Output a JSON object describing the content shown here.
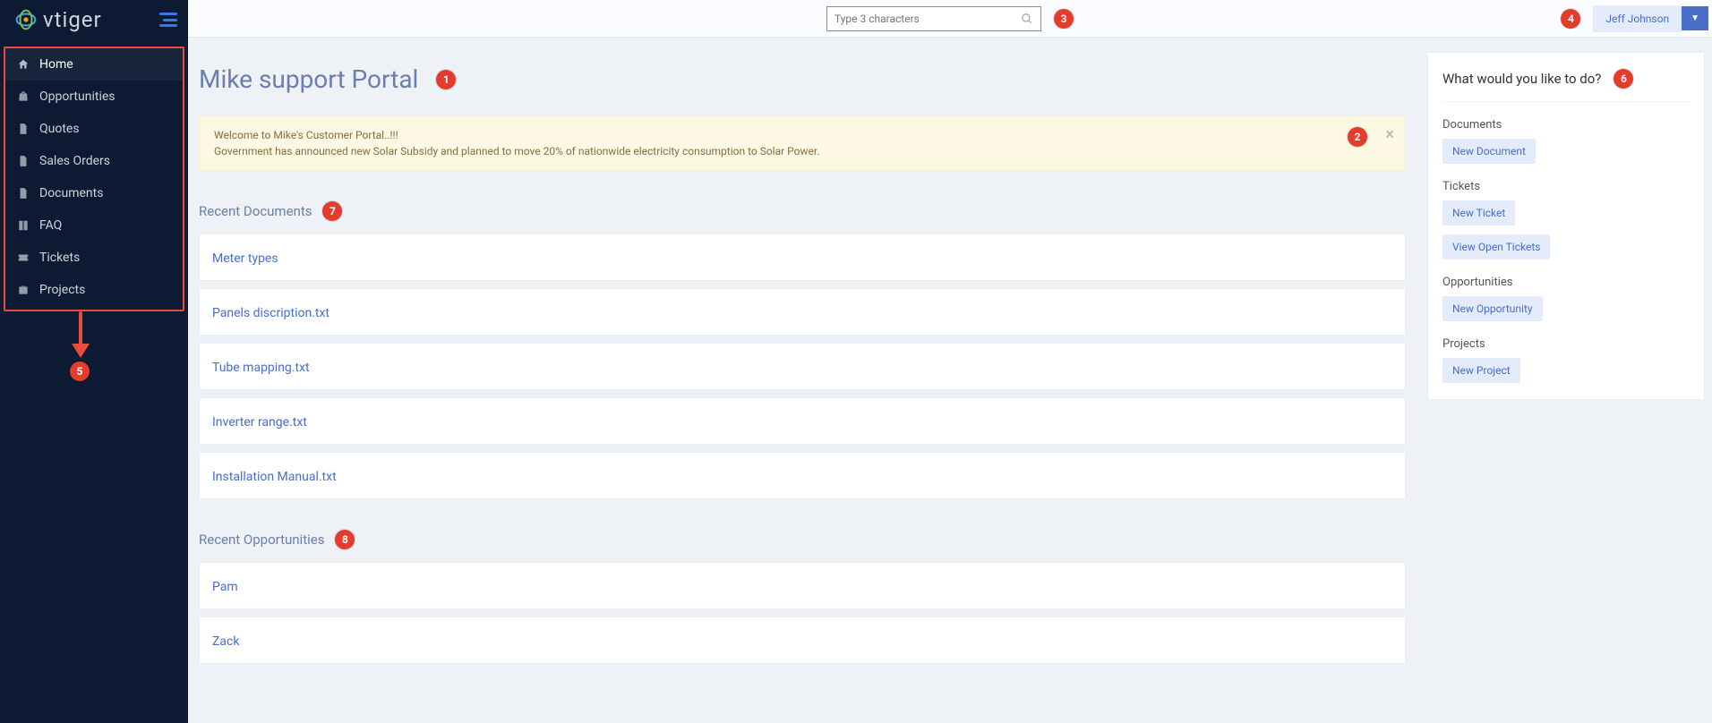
{
  "brand": {
    "name": "vtiger"
  },
  "search": {
    "placeholder": "Type 3 characters"
  },
  "user": {
    "name": "Jeff Johnson"
  },
  "badges": {
    "title": "1",
    "alert": "2",
    "search": "3",
    "user": "4",
    "nav": "5",
    "actions": "6",
    "recent_docs": "7",
    "recent_opps": "8"
  },
  "nav": {
    "items": [
      {
        "label": "Home",
        "icon": "home",
        "active": true
      },
      {
        "label": "Opportunities",
        "icon": "bag"
      },
      {
        "label": "Quotes",
        "icon": "doc"
      },
      {
        "label": "Sales Orders",
        "icon": "doc"
      },
      {
        "label": "Documents",
        "icon": "doc"
      },
      {
        "label": "FAQ",
        "icon": "book"
      },
      {
        "label": "Tickets",
        "icon": "ticket"
      },
      {
        "label": "Projects",
        "icon": "briefcase"
      }
    ]
  },
  "page": {
    "title": "Mike support Portal",
    "alert_line1": "Welcome to Mike's Customer Portal..!!!",
    "alert_line2": "Government has announced new Solar Subsidy and planned to move 20% of nationwide electricity consumption to Solar Power."
  },
  "sections": {
    "recent_documents": {
      "title": "Recent Documents",
      "items": [
        "Meter types",
        "Panels discription.txt",
        "Tube mapping.txt",
        "Inverter range.txt",
        "Installation Manual.txt"
      ]
    },
    "recent_opportunities": {
      "title": "Recent Opportunities",
      "items": [
        "Pam",
        "Zack"
      ]
    }
  },
  "actions_panel": {
    "title": "What would you like to do?",
    "groups": [
      {
        "label": "Documents",
        "buttons": [
          "New Document"
        ]
      },
      {
        "label": "Tickets",
        "buttons": [
          "New Ticket",
          "View Open Tickets"
        ]
      },
      {
        "label": "Opportunities",
        "buttons": [
          "New Opportunity"
        ]
      },
      {
        "label": "Projects",
        "buttons": [
          "New Project"
        ]
      }
    ]
  }
}
